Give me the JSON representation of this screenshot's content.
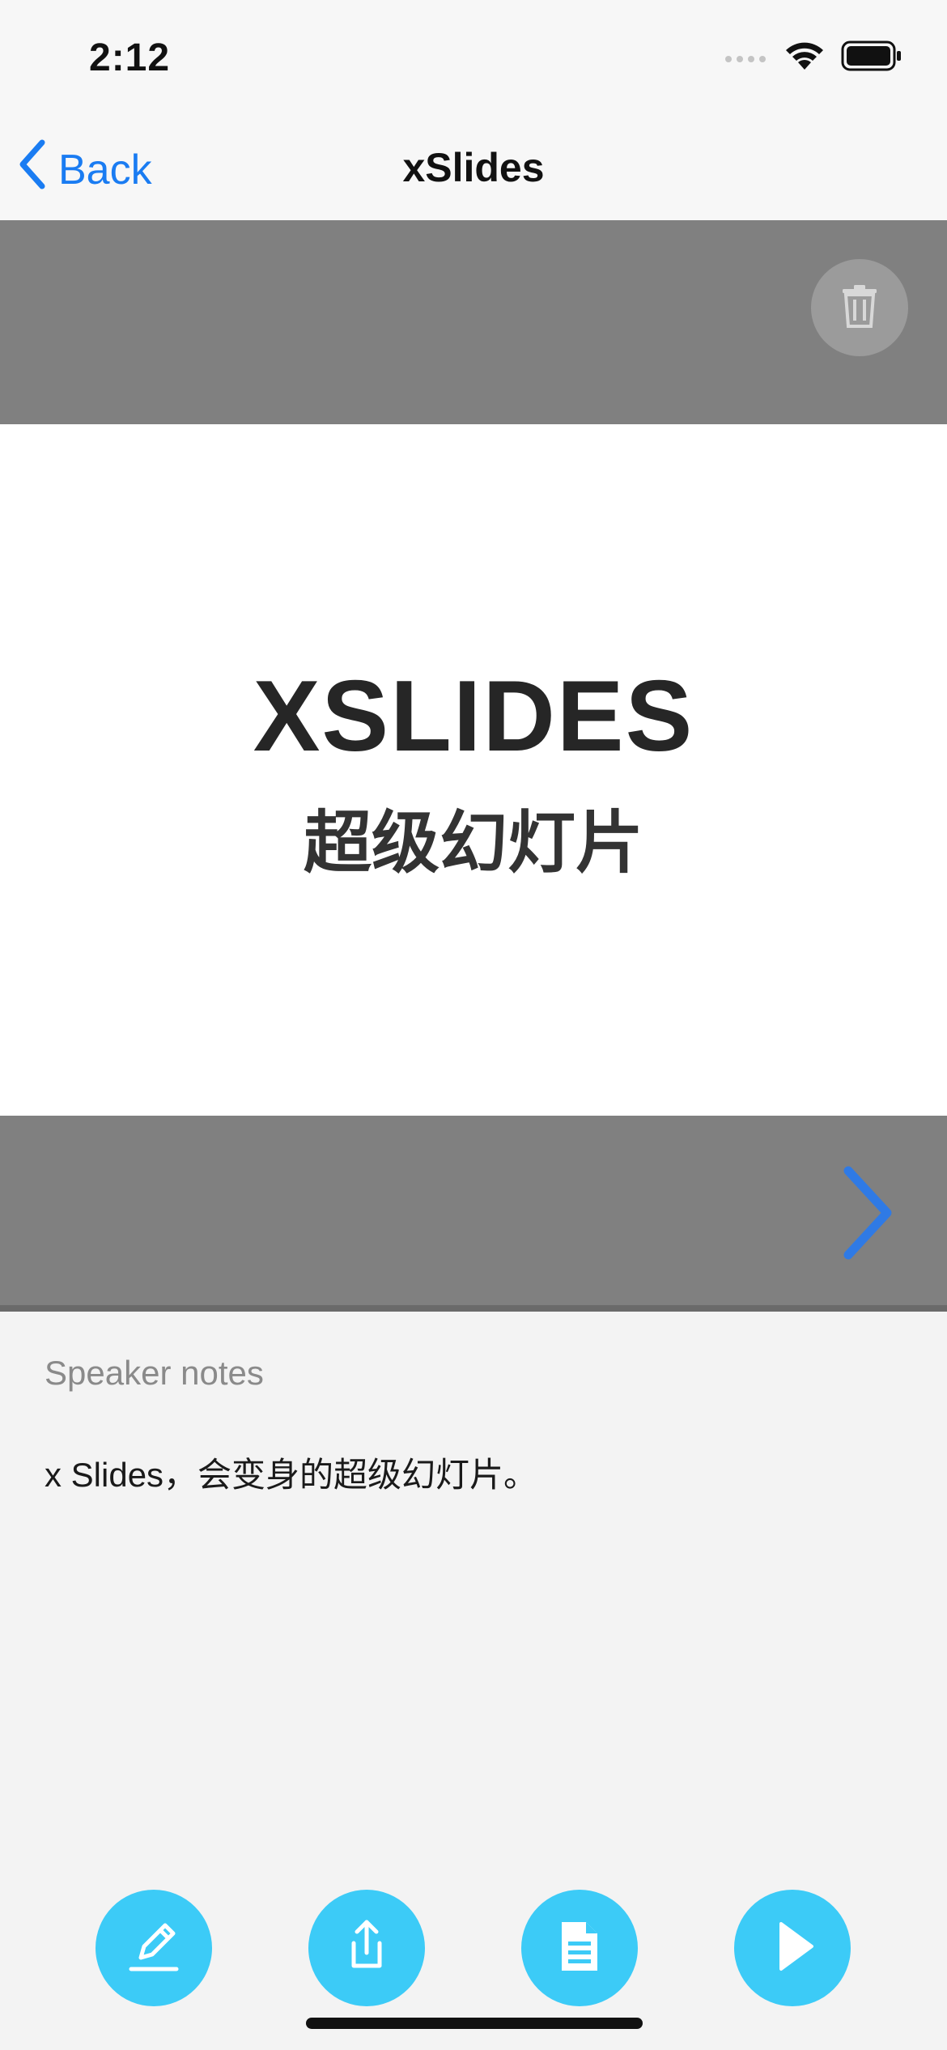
{
  "status_bar": {
    "time": "2:12"
  },
  "nav": {
    "back_label": "Back",
    "title": "xSlides"
  },
  "slide": {
    "title": "XSLIDES",
    "subtitle": "超级幻灯片"
  },
  "notes": {
    "label": "Speaker notes",
    "text": "x Slides，会变身的超级幻灯片。"
  },
  "toolbar": {
    "buttons": [
      {
        "icon": "pencil-icon"
      },
      {
        "icon": "share-icon"
      },
      {
        "icon": "document-icon"
      },
      {
        "icon": "play-icon"
      }
    ]
  },
  "colors": {
    "accent": "#1a7cf2",
    "toolbar_button": "#3ccbf7",
    "slide_band": "#808080",
    "next_arrow": "#2f7ae5"
  }
}
